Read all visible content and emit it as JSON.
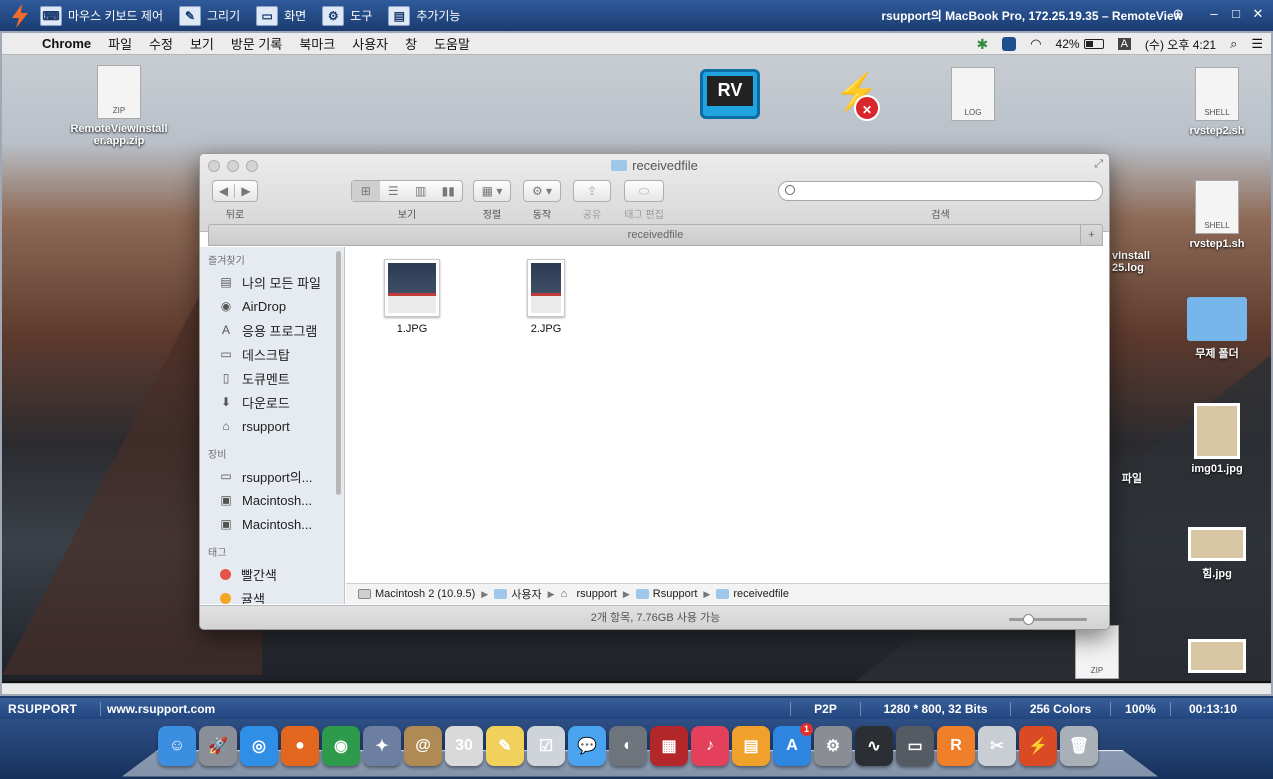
{
  "remoteview": {
    "tools": [
      {
        "icon": "keyboard-mouse-icon",
        "label": "마우스 키보드 제어"
      },
      {
        "icon": "draw-icon",
        "label": "그리기"
      },
      {
        "icon": "screen-icon",
        "label": "화면"
      },
      {
        "icon": "tools-icon",
        "label": "도구"
      },
      {
        "icon": "extras-icon",
        "label": "추가기능"
      }
    ],
    "window_title": "rsupport의 MacBook Pro, 172.25.19.35 – RemoteView",
    "status": {
      "brand": "RSUPPORT",
      "url": "www.rsupport.com",
      "mode": "P2P",
      "resolution": "1280 * 800, 32 Bits",
      "colors": "256 Colors",
      "zoom": "100%",
      "elapsed": "00:13:10"
    }
  },
  "menubar": {
    "app": "Chrome",
    "items": [
      "파일",
      "수정",
      "보기",
      "방문 기록",
      "북마크",
      "사용자",
      "창",
      "도움말"
    ],
    "battery": "42%",
    "input_source": "A",
    "clock": "(수) 오후 4:21"
  },
  "desktop": {
    "icons": [
      {
        "label_line1": "RemoteViewInstall",
        "label_line2": "er.app.zip",
        "badge": "ZIP"
      },
      {
        "label": "rvstep2.sh",
        "badge": "SHELL"
      },
      {
        "label": "rvstep1.sh",
        "badge": "SHELL"
      },
      {
        "label": "무제 폴더"
      },
      {
        "label": "img01.jpg"
      },
      {
        "label": "힘.jpg"
      },
      {
        "label": "ZIP"
      },
      {
        "label": "LOG"
      },
      {
        "label_line1": "vInstall",
        "label_line2": "25.log"
      },
      {
        "label": "파일"
      }
    ]
  },
  "finder": {
    "title": "receivedfile",
    "toolbar": {
      "back_label": "뒤로",
      "view_label": "보기",
      "arrange_label": "정렬",
      "action_label": "동작",
      "share_label": "공유",
      "tag_label": "태그 편집",
      "search_label": "검색",
      "search_value": ""
    },
    "tab_title": "receivedfile",
    "sidebar": {
      "favorites_header": "즐겨찾기",
      "favorites": [
        {
          "icon": "all-files-icon",
          "label": "나의 모든 파일"
        },
        {
          "icon": "airdrop-icon",
          "label": "AirDrop"
        },
        {
          "icon": "applications-icon",
          "label": "응용 프로그램"
        },
        {
          "icon": "desktop-icon",
          "label": "데스크탑"
        },
        {
          "icon": "documents-icon",
          "label": "도큐멘트"
        },
        {
          "icon": "downloads-icon",
          "label": "다운로드"
        },
        {
          "icon": "home-icon",
          "label": "rsupport"
        }
      ],
      "devices_header": "장비",
      "devices": [
        {
          "icon": "laptop-icon",
          "label": "rsupport의..."
        },
        {
          "icon": "disk-icon",
          "label": "Macintosh..."
        },
        {
          "icon": "disk-icon",
          "label": "Macintosh..."
        }
      ],
      "tags_header": "태그",
      "tags": [
        {
          "label": "빨간색",
          "color": "#e5534b"
        },
        {
          "label": "귤색",
          "color": "#f5a623"
        }
      ]
    },
    "files": [
      {
        "name": "1.JPG"
      },
      {
        "name": "2.JPG"
      }
    ],
    "path": [
      {
        "icon": "disk-icon",
        "label": "Macintosh 2 (10.9.5)"
      },
      {
        "icon": "folder-icon",
        "label": "사용자"
      },
      {
        "icon": "home-icon",
        "label": "rsupport"
      },
      {
        "icon": "folder-icon",
        "label": "Rsupport"
      },
      {
        "icon": "folder-icon",
        "label": "receivedfile"
      }
    ],
    "status": "2개 항목, 7.76GB 사용 가능"
  },
  "dock": {
    "apps": [
      {
        "name": "finder-icon",
        "glyph": "☺",
        "color": "#3b8ee0"
      },
      {
        "name": "launchpad-icon",
        "glyph": "🚀",
        "color": "#8a8f97"
      },
      {
        "name": "safari-icon",
        "glyph": "◎",
        "color": "#2f8ee6"
      },
      {
        "name": "firefox-icon",
        "glyph": "●",
        "color": "#e2661e"
      },
      {
        "name": "chrome-icon",
        "glyph": "◉",
        "color": "#2e9b4c"
      },
      {
        "name": "preview-icon",
        "glyph": "✦",
        "color": "#6c7fa0"
      },
      {
        "name": "contacts-icon",
        "glyph": "@",
        "color": "#b08a55"
      },
      {
        "name": "calendar-icon",
        "glyph": "30",
        "color": "#d9d9d9"
      },
      {
        "name": "notes-icon",
        "glyph": "✎",
        "color": "#f1d05b"
      },
      {
        "name": "reminders-icon",
        "glyph": "☑",
        "color": "#cfd4da"
      },
      {
        "name": "messages-icon",
        "glyph": "💬",
        "color": "#4aa3ef"
      },
      {
        "name": "facetime-icon",
        "glyph": "◐",
        "color": "#6d747c"
      },
      {
        "name": "photo-booth-icon",
        "glyph": "▦",
        "color": "#b3262a"
      },
      {
        "name": "itunes-icon",
        "glyph": "♪",
        "color": "#e43f5b"
      },
      {
        "name": "ibooks-icon",
        "glyph": "▤",
        "color": "#f0a12c"
      },
      {
        "name": "app-store-icon",
        "glyph": "A",
        "color": "#2f86e0",
        "badge": "1"
      },
      {
        "name": "system-preferences-icon",
        "glyph": "⚙",
        "color": "#8a8e94"
      },
      {
        "name": "activity-monitor-icon",
        "glyph": "∿",
        "color": "#2b2f33"
      },
      {
        "name": "terminal-icon",
        "glyph": "▭",
        "color": "#555b62"
      },
      {
        "name": "rsupport-icon",
        "glyph": "R",
        "color": "#f07f2a"
      },
      {
        "name": "utilities-icon",
        "glyph": "✂",
        "color": "#c9ced4"
      },
      {
        "name": "remoteview-icon",
        "glyph": "⚡",
        "color": "#d94a25"
      },
      {
        "name": "trash-icon",
        "glyph": "🗑",
        "color": "#aab0b7"
      }
    ]
  }
}
